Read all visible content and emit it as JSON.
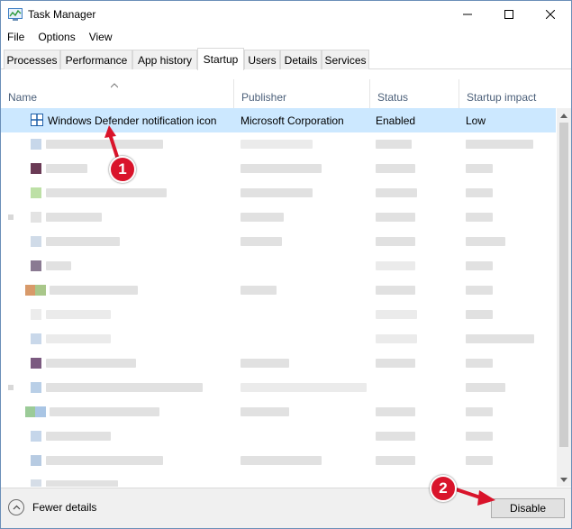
{
  "window": {
    "title": "Task Manager"
  },
  "menu": [
    "File",
    "Options",
    "View"
  ],
  "tabs": [
    "Processes",
    "Performance",
    "App history",
    "Startup",
    "Users",
    "Details",
    "Services"
  ],
  "active_tab": "Startup",
  "columns": [
    "Name",
    "Publisher",
    "Status",
    "Startup impact"
  ],
  "selected_row": {
    "name": "Windows Defender notification icon",
    "publisher": "Microsoft Corporation",
    "status": "Enabled",
    "impact": "Low"
  },
  "footer": {
    "fewer_details": "Fewer details",
    "disable": "Disable"
  },
  "annotations": {
    "badge1": "1",
    "badge2": "2"
  },
  "colors": {
    "selected_row": "#cce8ff",
    "badge": "#d9142b"
  },
  "icons": [
    "taskmanager-icon",
    "minimize-icon",
    "maximize-icon",
    "close-icon",
    "sort-caret-icon",
    "defender-icon",
    "chevron-up-icon"
  ]
}
